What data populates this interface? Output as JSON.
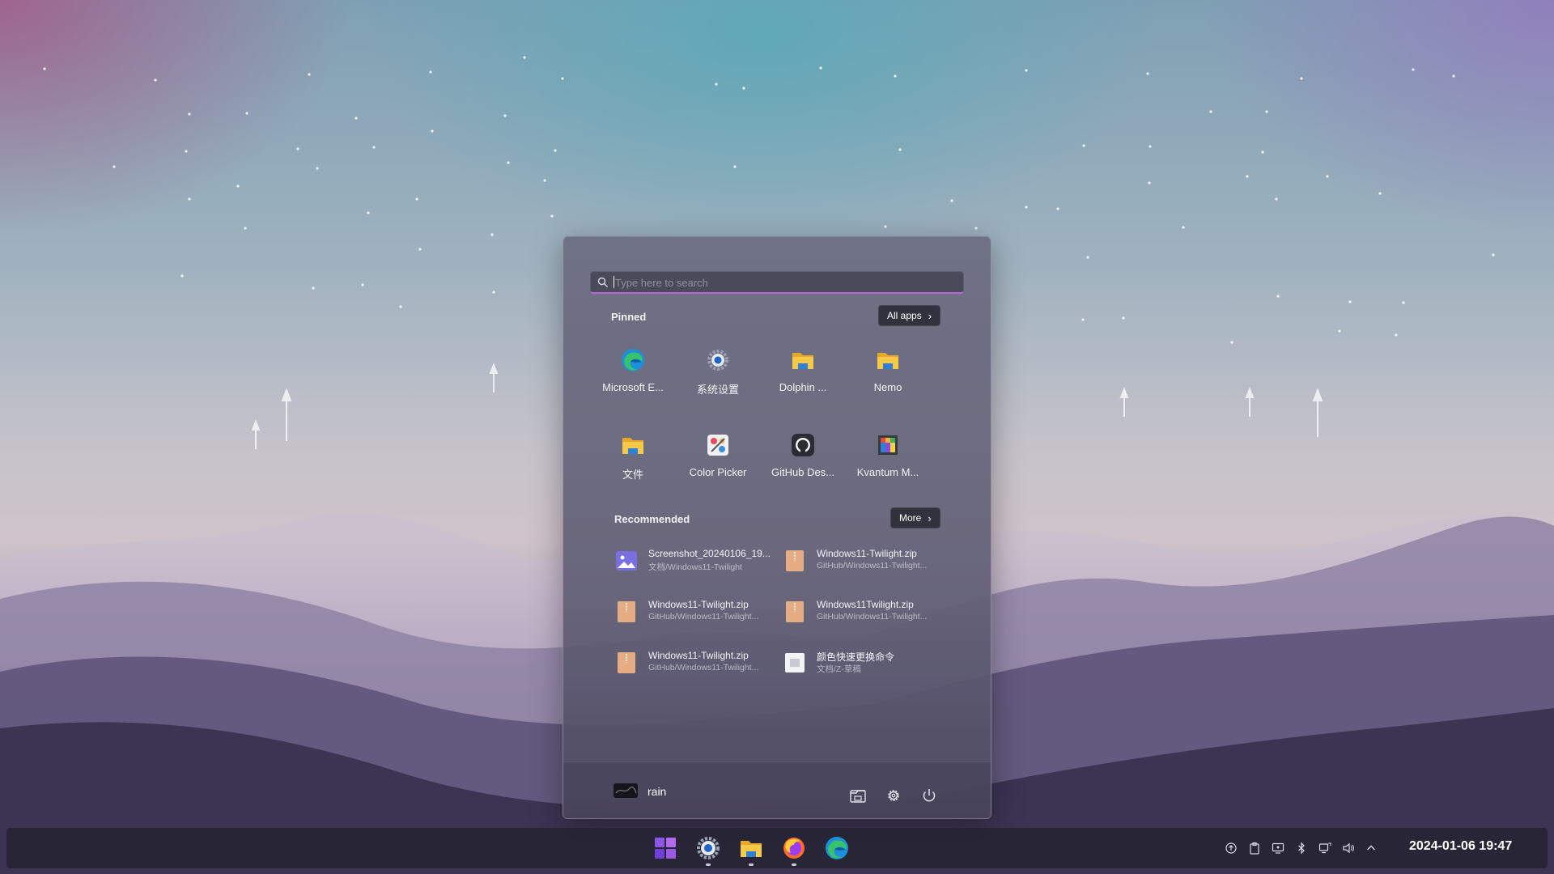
{
  "search": {
    "placeholder": "Type here to search"
  },
  "pinned": {
    "title": "Pinned",
    "all_apps_label": "All apps",
    "apps": [
      {
        "label": "Microsoft E...",
        "icon": "edge-icon"
      },
      {
        "label": "系统设置",
        "icon": "settings-icon"
      },
      {
        "label": "Dolphin ...",
        "icon": "folder-icon"
      },
      {
        "label": "Nemo",
        "icon": "folder-icon"
      },
      {
        "label": "文件",
        "icon": "folder-icon"
      },
      {
        "label": "Color Picker",
        "icon": "color-picker-icon"
      },
      {
        "label": "GitHub Des...",
        "icon": "github-icon"
      },
      {
        "label": "Kvantum M...",
        "icon": "kvantum-icon"
      }
    ]
  },
  "recommended": {
    "title": "Recommended",
    "more_label": "More",
    "items": [
      {
        "name": "Screenshot_20240106_19...",
        "path": "文档/Windows11-Twilight",
        "icon": "image-file-icon"
      },
      {
        "name": "Windows11-Twilight.zip",
        "path": "GitHub/Windows11-Twilight...",
        "icon": "archive-icon"
      },
      {
        "name": "Windows11-Twilight.zip",
        "path": "GitHub/Windows11-Twilight...",
        "icon": "archive-icon"
      },
      {
        "name": "Windows11Twilight.zip",
        "path": "GitHub/Windows11-Twilight...",
        "icon": "archive-icon"
      },
      {
        "name": "Windows11-Twilight.zip",
        "path": "GitHub/Windows11-Twilight...",
        "icon": "archive-icon"
      },
      {
        "name": "颜色快速更换命令",
        "path": "文档/Z-草稿",
        "icon": "document-icon"
      }
    ]
  },
  "user": {
    "name": "rain"
  },
  "taskbar": {
    "clock": "2024-01-06 19:47",
    "apps": [
      "start-icon",
      "settings-icon",
      "file-manager-icon",
      "firefox-icon",
      "edge-icon"
    ]
  },
  "colors": {
    "accent": "#b46ad8",
    "taskbar": "#262434"
  }
}
